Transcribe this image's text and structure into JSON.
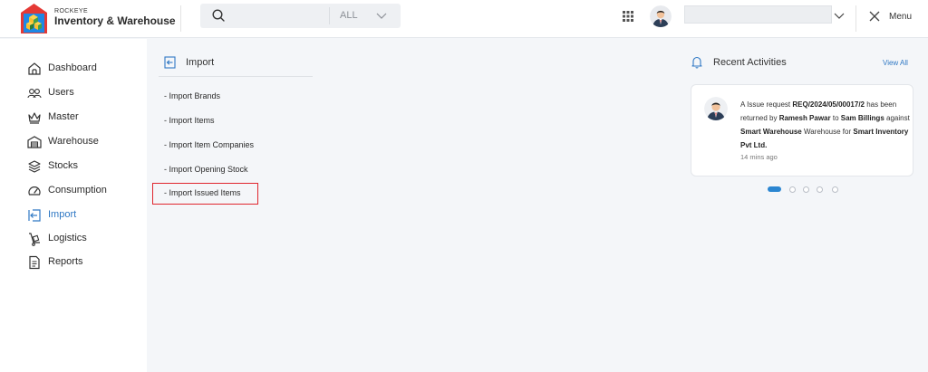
{
  "header": {
    "brand_small": "ROCKEYE",
    "brand_title": "Inventory & Warehouse",
    "search": {
      "placeholder": "",
      "category": "ALL"
    },
    "user_name": "",
    "menu_label": "Menu"
  },
  "sidebar": {
    "items": [
      {
        "label": "Dashboard",
        "icon": "house-icon",
        "active": false
      },
      {
        "label": "Users",
        "icon": "users-icon",
        "active": false
      },
      {
        "label": "Master",
        "icon": "crown-icon",
        "active": false
      },
      {
        "label": "Warehouse",
        "icon": "warehouse-icon",
        "active": false
      },
      {
        "label": "Stocks",
        "icon": "layers-icon",
        "active": false
      },
      {
        "label": "Consumption",
        "icon": "gauge-icon",
        "active": false
      },
      {
        "label": "Import",
        "icon": "import-icon",
        "active": true
      },
      {
        "label": "Logistics",
        "icon": "dolly-icon",
        "active": false
      },
      {
        "label": "Reports",
        "icon": "document-icon",
        "active": false
      }
    ]
  },
  "main": {
    "title": "Import",
    "links": [
      "- Import Brands",
      "- Import Items",
      "- Import Item Companies",
      "- Import Opening Stock",
      "- Import Issued Items"
    ]
  },
  "recent": {
    "title": "Recent Activities",
    "view_all": "View All",
    "card": {
      "t1": "A Issue request ",
      "b1": "REQ/2024/05/00017/2",
      "t2": " has been returned by ",
      "b2": "Ramesh Pawar",
      "t3": " to ",
      "b3": "Sam Billings",
      "t4": " against ",
      "b4": "Smart Warehouse",
      "t5": " Warehouse for ",
      "b5": "Smart Inventory Pvt Ltd.",
      "time": "14 mins ago"
    }
  },
  "colors": {
    "accent": "#2f78c4",
    "highlight": "#e0262e",
    "dot_active": "#2b86d1"
  }
}
